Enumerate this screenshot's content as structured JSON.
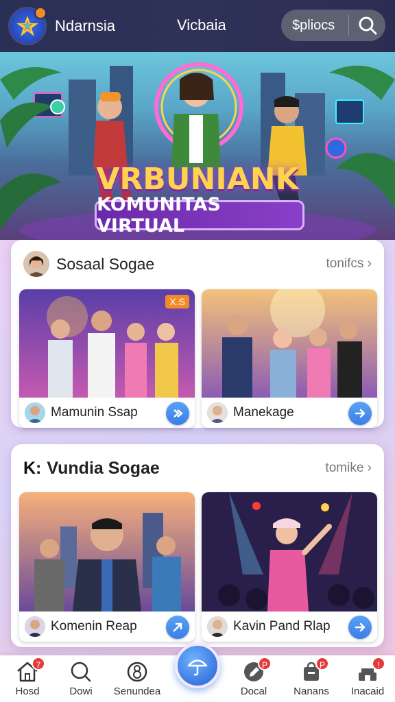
{
  "header": {
    "app_name": "Ndarnsia",
    "center_title": "Vicbaia",
    "search_pill_text": "$pliocs"
  },
  "hero": {
    "title": "VRBUNIANK",
    "subtitle": "KOMUNITAS VIRTUAL"
  },
  "sections": [
    {
      "title": "Sosaal Sogae",
      "see_more": "tonifcs ›",
      "cards": [
        {
          "label": "Mamunin Ssap",
          "badge": "X.S"
        },
        {
          "label": "Manekage"
        }
      ]
    },
    {
      "prefix": "K:",
      "title": "Vundia Sogae",
      "see_more": "tomike ›",
      "cards": [
        {
          "label": "Komenin Reap"
        },
        {
          "label": "Kavin Pand Rlap"
        }
      ]
    }
  ],
  "bottom_nav": {
    "items": [
      {
        "label": "Hosd",
        "icon": "home-icon",
        "badge": "7"
      },
      {
        "label": "Dowi",
        "icon": "search-icon"
      },
      {
        "label": "Senundea",
        "icon": "chat-icon"
      },
      {
        "label": "Docal",
        "icon": "pen-icon",
        "badge": "P"
      },
      {
        "label": "Nanans",
        "icon": "bag-icon",
        "badge": "P"
      },
      {
        "label": "Inacaid",
        "icon": "store-icon",
        "badge": "!"
      }
    ],
    "fab_icon": "umbrella-icon"
  },
  "colors": {
    "topbar": "#2a2f55",
    "accent": "#3a7ee6",
    "hero_title": "#ffd34d",
    "hero_subtitle_bg": "#7a35b8",
    "badge": "#e53a3a"
  }
}
